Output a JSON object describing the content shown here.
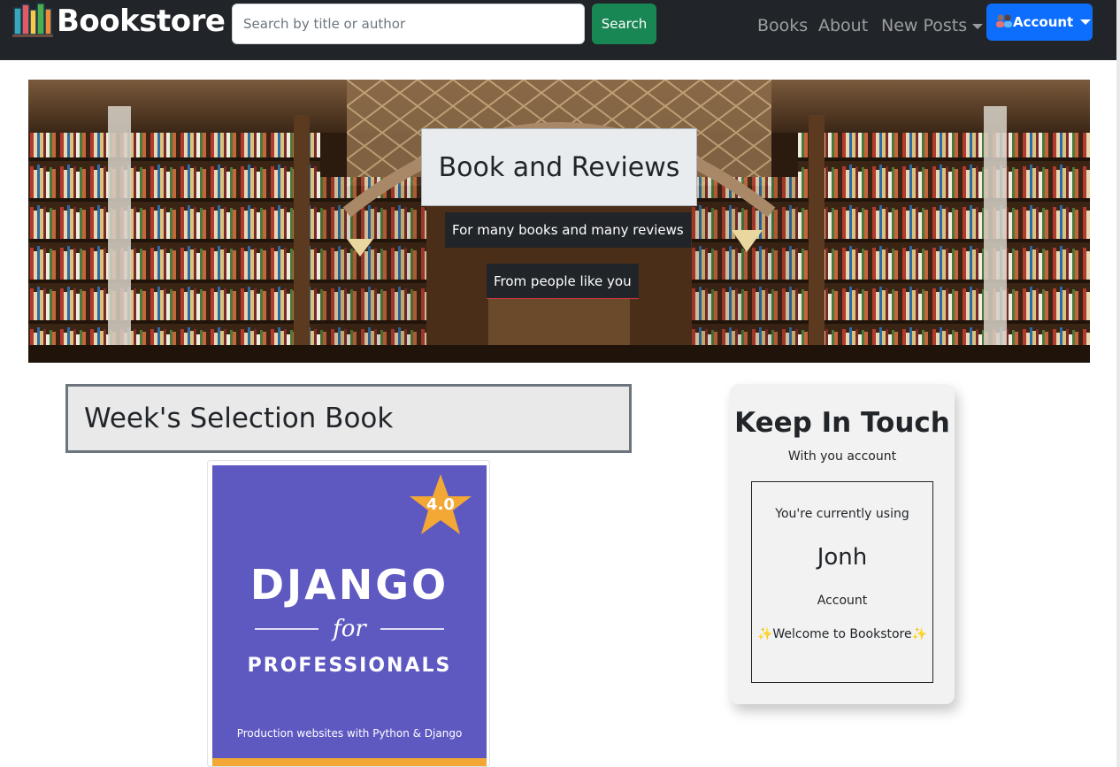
{
  "navbar": {
    "brand_icon": "books-icon",
    "brand_label": "Bookstore",
    "search": {
      "placeholder": "Search by title or author",
      "value": ""
    },
    "search_button_label": "Search",
    "links": {
      "books": "Books",
      "about": "About",
      "new_posts": "New Posts"
    },
    "account": {
      "icon": "people-icon",
      "label": "Account"
    }
  },
  "hero": {
    "title": "Book and Reviews",
    "subtitle_1": "For many books and many reviews",
    "subtitle_2": "From people like you"
  },
  "week_selection": {
    "heading": "Week's Selection Book",
    "book": {
      "title_line_1": "DJANGO",
      "title_line_2": "for",
      "title_line_3": "PROFESSIONALS",
      "tagline": "Production websites with Python & Django",
      "rating": "4.0"
    }
  },
  "keep_in_touch": {
    "title": "Keep In Touch",
    "subtitle": "With you account",
    "using_label": "You're currently using",
    "username": "Jonh",
    "account_label": "Account",
    "welcome": "Welcome to Bookstore",
    "welcome_icon": "sparkles-icon"
  },
  "colors": {
    "navbar_bg": "#212529",
    "search_button": "#198754",
    "account_button": "#0d6efd",
    "book_cover": "#5e59c1",
    "rating_star": "#f3a735"
  }
}
